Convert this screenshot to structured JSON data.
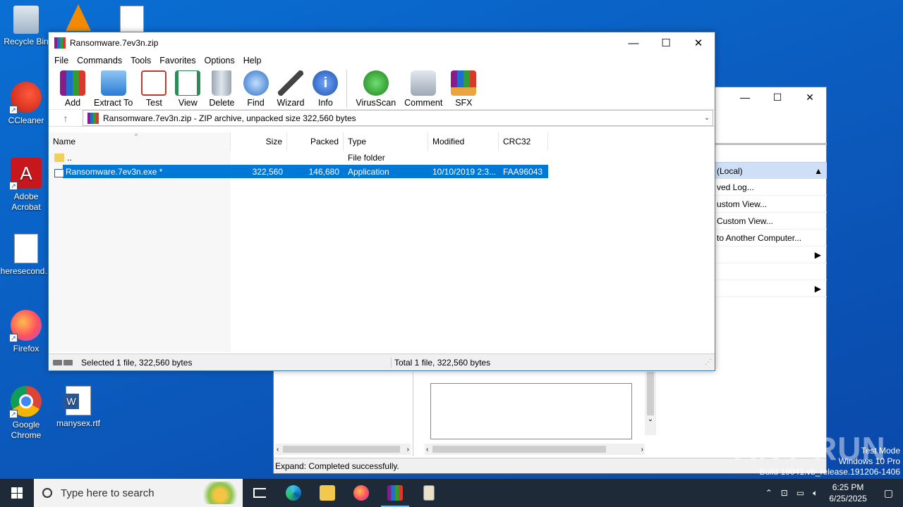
{
  "desktop": {
    "icons": [
      {
        "label": "Recycle Bin",
        "icon": "recycle-bin-icon"
      },
      {
        "label": "CCleaner",
        "icon": "ccleaner-icon"
      },
      {
        "label": "Adobe Acrobat",
        "icon": "acrobat-icon"
      },
      {
        "label": "heresecond...",
        "icon": "image-file-icon"
      },
      {
        "label": "Firefox",
        "icon": "firefox-icon"
      },
      {
        "label": "Google Chrome",
        "icon": "chrome-icon"
      },
      {
        "label": "manysex.rtf",
        "icon": "word-doc-icon"
      }
    ]
  },
  "background_window": {
    "action_header": "(Local)",
    "actions": [
      "ved Log...",
      "ustom View...",
      "Custom View...",
      "to Another Computer...",
      "",
      ""
    ],
    "status": "Expand:  Completed successfully."
  },
  "winrar": {
    "title": "Ransomware.7ev3n.zip",
    "menu": [
      "File",
      "Commands",
      "Tools",
      "Favorites",
      "Options",
      "Help"
    ],
    "toolbar": [
      "Add",
      "Extract To",
      "Test",
      "View",
      "Delete",
      "Find",
      "Wizard",
      "Info",
      "VirusScan",
      "Comment",
      "SFX"
    ],
    "address": "Ransomware.7ev3n.zip - ZIP archive, unpacked size 322,560 bytes",
    "columns": [
      "Name",
      "Size",
      "Packed",
      "Type",
      "Modified",
      "CRC32"
    ],
    "rows": [
      {
        "name": "..",
        "size": "",
        "packed": "",
        "type": "File folder",
        "modified": "",
        "crc": ""
      },
      {
        "name": "Ransomware.7ev3n.exe *",
        "size": "322,560",
        "packed": "146,680",
        "type": "Application",
        "modified": "10/10/2019 2:3...",
        "crc": "FAA96043"
      }
    ],
    "status_left": "Selected 1 file, 322,560 bytes",
    "status_right": "Total 1 file, 322,560 bytes"
  },
  "taskbar": {
    "search_placeholder": "Type here to search",
    "time": "6:25 PM",
    "date": "6/25/2025"
  },
  "watermark": {
    "line1": "Test Mode",
    "line2": "Windows 10 Pro",
    "line3": "Build 19041.vb_release.191206-1406",
    "brand": "ANY RUN"
  },
  "colors": {
    "selection": "#0078d7",
    "desktop": "#0b5cbf",
    "taskbar": "#1f2a38"
  }
}
